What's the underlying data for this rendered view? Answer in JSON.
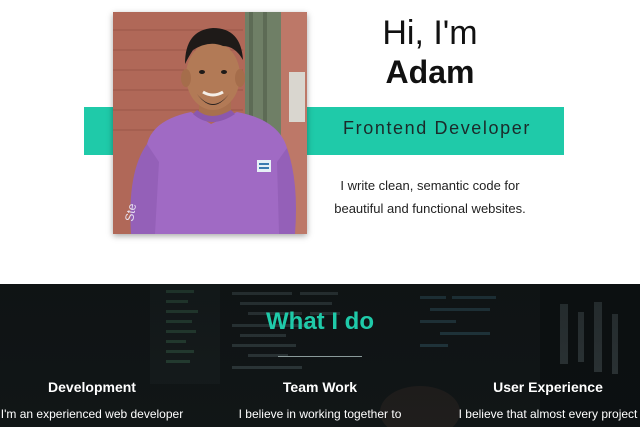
{
  "hero": {
    "greeting": "Hi, I'm",
    "name": "Adam",
    "role": "Frontend Developer",
    "intro": "I write clean, semantic code for beautiful and functional websites.",
    "accent": "#1fcaa9"
  },
  "services": {
    "title": "What I do",
    "items": [
      {
        "heading": "Development",
        "text": "I'm an experienced web developer"
      },
      {
        "heading": "Team Work",
        "text": "I believe in working together to"
      },
      {
        "heading": "User Experience",
        "text": "I believe that almost every project"
      }
    ]
  }
}
